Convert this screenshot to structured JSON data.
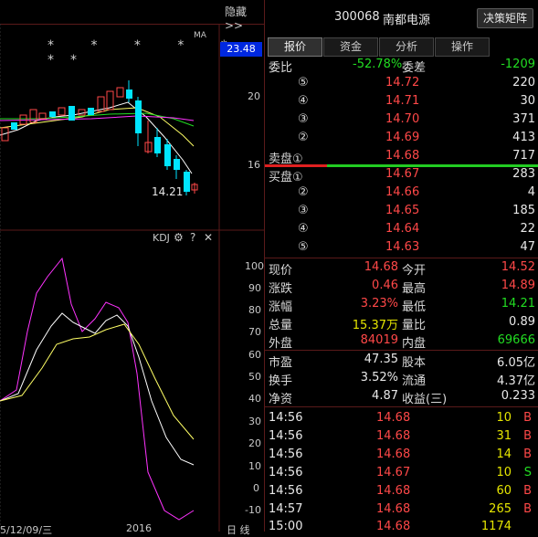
{
  "chart": {
    "hide_label": "隐藏>>",
    "ma_label": "MA",
    "stars": "* * * * * **",
    "price_badge": "23.48",
    "price_axis": [
      "20",
      "16"
    ],
    "low_label": "14.21",
    "kdj_label": "KDJ",
    "gear_icon": "⚙",
    "help_icon": "?",
    "close_icon": "✕",
    "kdj_axis": [
      "100",
      "90",
      "80",
      "70",
      "60",
      "50",
      "40",
      "30",
      "20",
      "10",
      "0",
      "-10"
    ],
    "bottom_left": "5/12/09/三",
    "bottom_mid": "2016",
    "bottom_right": "日 线"
  },
  "header": {
    "code": "300068",
    "name": "南都电源",
    "decision_button": "决策矩阵"
  },
  "tabs": [
    "报价",
    "资金",
    "分析",
    "操作"
  ],
  "order_ratio": {
    "label1": "委比",
    "value1": "-52.78%",
    "label2": "委差",
    "value2": "-1209"
  },
  "asks": [
    {
      "label": "⑤",
      "price": "14.72",
      "vol": "220"
    },
    {
      "label": "④",
      "price": "14.71",
      "vol": "30"
    },
    {
      "label": "③",
      "price": "14.70",
      "vol": "371"
    },
    {
      "label": "②",
      "price": "14.69",
      "vol": "413"
    },
    {
      "label": "卖盘①",
      "price": "14.68",
      "vol": "717"
    }
  ],
  "bids": [
    {
      "label": "买盘①",
      "price": "14.67",
      "vol": "283"
    },
    {
      "label": "②",
      "price": "14.66",
      "vol": "4"
    },
    {
      "label": "③",
      "price": "14.65",
      "vol": "185"
    },
    {
      "label": "④",
      "price": "14.64",
      "vol": "22"
    },
    {
      "label": "⑤",
      "price": "14.63",
      "vol": "47"
    }
  ],
  "quote": [
    {
      "l1": "现价",
      "v1": "14.68",
      "c1": "red",
      "l2": "今开",
      "v2": "14.52",
      "c2": "red"
    },
    {
      "l1": "涨跌",
      "v1": "0.46",
      "c1": "red",
      "l2": "最高",
      "v2": "14.89",
      "c2": "red"
    },
    {
      "l1": "涨幅",
      "v1": "3.23%",
      "c1": "red",
      "l2": "最低",
      "v2": "14.21",
      "c2": "green"
    },
    {
      "l1": "总量",
      "v1": "15.37万",
      "c1": "yel",
      "l2": "量比",
      "v2": "0.89",
      "c2": "wht"
    },
    {
      "l1": "外盘",
      "v1": "84019",
      "c1": "red",
      "l2": "内盘",
      "v2": "69666",
      "c2": "green"
    }
  ],
  "fundamentals": [
    {
      "l1": "市盈",
      "v1": "47.35",
      "l2": "股本",
      "v2": "6.05亿"
    },
    {
      "l1": "换手",
      "v1": "3.52%",
      "l2": "流通",
      "v2": "4.37亿"
    },
    {
      "l1": "净资",
      "v1": "4.87",
      "l2": "收益(三)",
      "v2": "0.233"
    }
  ],
  "ticks": [
    {
      "time": "14:56",
      "price": "14.68",
      "vol": "10",
      "side": "B"
    },
    {
      "time": "14:56",
      "price": "14.68",
      "vol": "31",
      "side": "B"
    },
    {
      "time": "14:56",
      "price": "14.68",
      "vol": "14",
      "side": "B"
    },
    {
      "time": "14:56",
      "price": "14.67",
      "vol": "10",
      "side": "S"
    },
    {
      "time": "14:56",
      "price": "14.68",
      "vol": "60",
      "side": "B"
    },
    {
      "time": "14:57",
      "price": "14.68",
      "vol": "265",
      "side": "B"
    },
    {
      "time": "15:00",
      "price": "14.68",
      "vol": "1174",
      "side": ""
    }
  ],
  "colors": {
    "up": "#ff4848",
    "down": "#22dd22",
    "volume": "#e6e600",
    "candle_down": "#00e5ff",
    "kdj_k": "#ffffff",
    "kdj_d": "#ffff66",
    "kdj_j": "#ff33ff"
  }
}
